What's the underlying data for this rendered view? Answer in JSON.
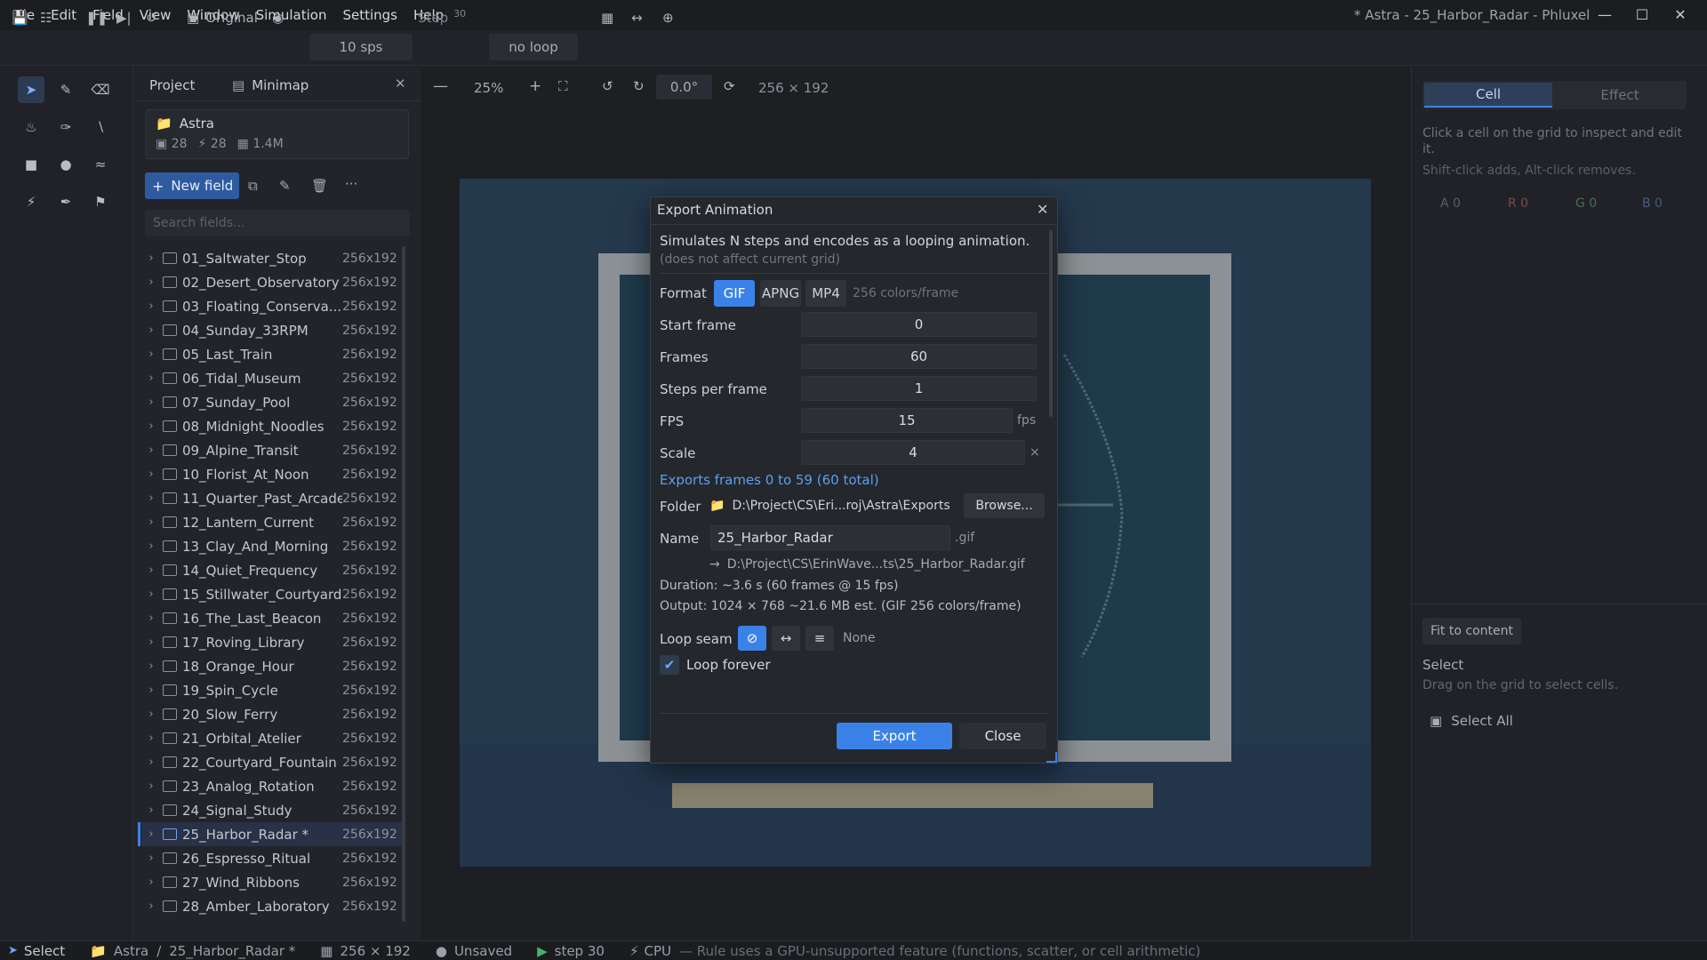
{
  "menubar": {
    "items": [
      "File",
      "Edit",
      "Field",
      "View",
      "Window",
      "Simulation",
      "Settings",
      "Help"
    ],
    "window_title": "* Astra - 25_Harbor_Radar - Phluxel"
  },
  "toolbar": {
    "original_label": "Original",
    "speed": "10 sps",
    "step_label": "Step",
    "step_value": "30",
    "loop": "no loop"
  },
  "project_panel": {
    "tab_project": "Project",
    "tab_minimap": "Minimap",
    "project_name": "Astra",
    "stat_fields": "28",
    "stat_rules": "28",
    "stat_cells": "1.4M",
    "new_field_label": "New field",
    "search_placeholder": "Search fields...",
    "fields": [
      {
        "name": "01_Saltwater_Stop",
        "size": "256x192"
      },
      {
        "name": "02_Desert_Observatory",
        "size": "256x192"
      },
      {
        "name": "03_Floating_Conserva...",
        "size": "256x192"
      },
      {
        "name": "04_Sunday_33RPM",
        "size": "256x192"
      },
      {
        "name": "05_Last_Train",
        "size": "256x192"
      },
      {
        "name": "06_Tidal_Museum",
        "size": "256x192"
      },
      {
        "name": "07_Sunday_Pool",
        "size": "256x192"
      },
      {
        "name": "08_Midnight_Noodles",
        "size": "256x192"
      },
      {
        "name": "09_Alpine_Transit",
        "size": "256x192"
      },
      {
        "name": "10_Florist_At_Noon",
        "size": "256x192"
      },
      {
        "name": "11_Quarter_Past_Arcade",
        "size": "256x192"
      },
      {
        "name": "12_Lantern_Current",
        "size": "256x192"
      },
      {
        "name": "13_Clay_And_Morning",
        "size": "256x192"
      },
      {
        "name": "14_Quiet_Frequency",
        "size": "256x192"
      },
      {
        "name": "15_Stillwater_Courtyard",
        "size": "256x192"
      },
      {
        "name": "16_The_Last_Beacon",
        "size": "256x192"
      },
      {
        "name": "17_Roving_Library",
        "size": "256x192"
      },
      {
        "name": "18_Orange_Hour",
        "size": "256x192"
      },
      {
        "name": "19_Spin_Cycle",
        "size": "256x192"
      },
      {
        "name": "20_Slow_Ferry",
        "size": "256x192"
      },
      {
        "name": "21_Orbital_Atelier",
        "size": "256x192"
      },
      {
        "name": "22_Courtyard_Fountain",
        "size": "256x192"
      },
      {
        "name": "23_Analog_Rotation",
        "size": "256x192"
      },
      {
        "name": "24_Signal_Study",
        "size": "256x192"
      },
      {
        "name": "25_Harbor_Radar  *",
        "size": "256x192"
      },
      {
        "name": "26_Espresso_Ritual",
        "size": "256x192"
      },
      {
        "name": "27_Wind_Ribbons",
        "size": "256x192"
      },
      {
        "name": "28_Amber_Laboratory",
        "size": "256x192"
      }
    ],
    "selected_index": 24
  },
  "canvas_toolbar": {
    "zoom": "25%",
    "rotation": "0.0°",
    "dimensions": "256 × 192"
  },
  "right_panel": {
    "tab_cell": "Cell",
    "tab_effect": "Effect",
    "hint1": "Click a cell on the grid to inspect and edit it.",
    "hint2": "Shift-click adds, Alt-click removes.",
    "channels": [
      "A 0",
      "R 0",
      "G 0",
      "B 0"
    ],
    "fit_label": "Fit to content",
    "select_title": "Select",
    "select_hint": "Drag on the grid to select cells.",
    "select_all": "Select All"
  },
  "dialog": {
    "title": "Export Animation",
    "desc1": "Simulates N steps and encodes as a looping animation.",
    "desc2": "(does not affect current grid)",
    "format_label": "Format",
    "formats": [
      "GIF",
      "APNG",
      "MP4"
    ],
    "format_note": "256 colors/frame",
    "start_frame_label": "Start frame",
    "start_frame": "0",
    "frames_label": "Frames",
    "frames": "60",
    "steps_label": "Steps per frame",
    "steps": "1",
    "fps_label": "FPS",
    "fps": "15",
    "fps_unit": "fps",
    "scale_label": "Scale",
    "scale": "4",
    "scale_unit": "×",
    "exports_info": "Exports frames 0 to 59  (60 total)",
    "folder_label": "Folder",
    "folder_path": "D:\\Project\\CS\\Eri...roj\\Astra\\Exports",
    "browse_label": "Browse...",
    "name_label": "Name",
    "name_value": "25_Harbor_Radar",
    "name_ext": ".gif",
    "full_path": "D:\\Project\\CS\\ErinWave...ts\\25_Harbor_Radar.gif",
    "duration": "Duration: ~3.6 s  (60 frames @ 15 fps)",
    "output": "Output: 1024 × 768   ~21.6 MB est. (GIF 256 colors/frame)",
    "loop_seam_label": "Loop seam",
    "loop_seam_value": "None",
    "loop_forever_label": "Loop forever",
    "export_label": "Export",
    "close_label": "Close"
  },
  "statusbar": {
    "mode": "Select",
    "project": "Astra",
    "separator": "/",
    "field": "25_Harbor_Radar *",
    "dims": "256 × 192",
    "saved": "Unsaved",
    "step": "step 30",
    "backend": "CPU",
    "note": "— Rule uses a GPU-unsupported feature (functions, scatter, or cell arithmetic)"
  },
  "colors": {
    "accent": "#3b82e8",
    "background": "#1e2024",
    "stage": "#25394d"
  }
}
